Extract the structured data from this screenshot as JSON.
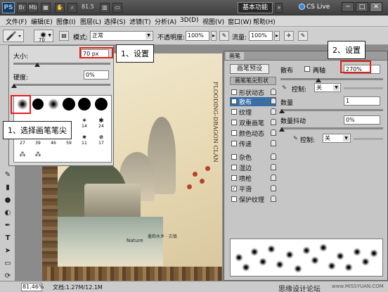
{
  "titlebar": {
    "logo": "PS",
    "zoom": "81.5",
    "workspace": "基本功能",
    "cs_live": "CS Live",
    "min": "─",
    "max": "□",
    "close": "✕"
  },
  "menu": [
    "文件(F)",
    "编辑(E)",
    "图像(I)",
    "图层(L)",
    "选择(S)",
    "滤镜(T)",
    "分析(A)",
    "3D(D)",
    "视图(V)",
    "窗口(W)",
    "帮助(H)"
  ],
  "options": {
    "brush_size_label": "70",
    "mode_label": "模式:",
    "mode_value": "正常",
    "opacity_label": "不透明度:",
    "opacity_value": "100%",
    "flow_label": "流量:",
    "flow_value": "100%"
  },
  "brush_picker": {
    "size_label": "大小:",
    "size_value": "70 px",
    "hardness_label": "硬度:",
    "hardness_value": "0%",
    "row2_numbers": [
      "",
      "",
      "",
      "",
      "",
      "14",
      "24"
    ],
    "row3_numbers": [
      "27",
      "39",
      "46",
      "59",
      "11",
      "17"
    ]
  },
  "callouts": {
    "set1": "1、设置",
    "select_tip": "1、选择画笔笔尖",
    "set2": "2、设置"
  },
  "brush_panel": {
    "tab": "画笔",
    "presets_button": "画笔预设",
    "tip_shape": "画笔笔尖形状",
    "options": [
      {
        "label": "形状动态",
        "checked": false,
        "selected": false
      },
      {
        "label": "散布",
        "checked": true,
        "selected": true
      },
      {
        "label": "纹理",
        "checked": false,
        "selected": false
      },
      {
        "label": "双重画笔",
        "checked": false,
        "selected": false
      },
      {
        "label": "颜色动态",
        "checked": false,
        "selected": false
      },
      {
        "label": "传递",
        "checked": false,
        "selected": false
      },
      {
        "label": "杂色",
        "checked": false,
        "selected": false
      },
      {
        "label": "湿边",
        "checked": false,
        "selected": false
      },
      {
        "label": "喷枪",
        "checked": false,
        "selected": false
      },
      {
        "label": "平滑",
        "checked": true,
        "selected": false
      },
      {
        "label": "保护纹理",
        "checked": false,
        "selected": false
      }
    ],
    "scatter_label": "散布",
    "both_axes_label": "两轴",
    "scatter_value": "270%",
    "control_label": "控制:",
    "control_value": "关",
    "count_label": "数量",
    "count_value": "1",
    "count_jitter_label": "数量抖动",
    "count_jitter_value": "0%",
    "control2_label": "控制:",
    "control2_value": "关"
  },
  "document": {
    "vertical_text": "FLOODING-DRAGON CLAN",
    "caption": "墨韵水乡 · 古镇",
    "brand": "Nature"
  },
  "statusbar": {
    "zoom": "81.46%",
    "doc_info": "文档:1.27M/12.1M",
    "watermark": "思缘设计论坛",
    "watermark_url": "www.MISSYUAN.COM"
  }
}
